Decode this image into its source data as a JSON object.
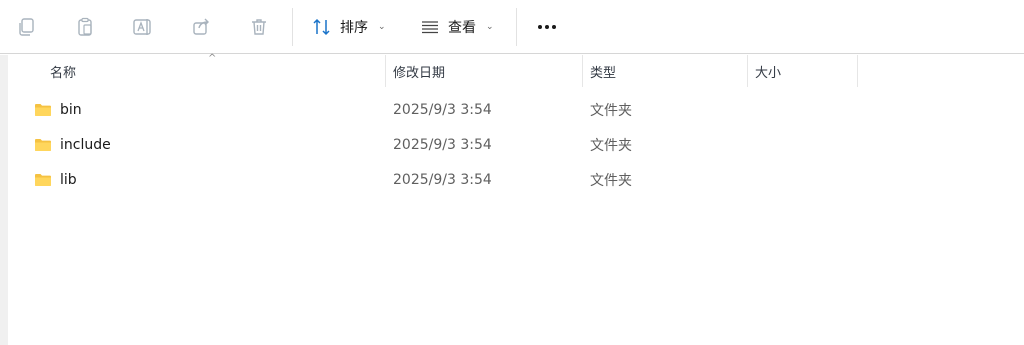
{
  "toolbar": {
    "icons": [
      "copy-icon",
      "paste-icon",
      "rename-icon",
      "share-icon",
      "delete-icon"
    ],
    "sort_label": "排序",
    "view_label": "查看",
    "accent": "#1a73c9"
  },
  "columns": {
    "name": "名称",
    "modified": "修改日期",
    "type": "类型",
    "size": "大小"
  },
  "files": [
    {
      "name": "bin",
      "modified": "2025/9/3 3:54",
      "type": "文件夹",
      "icon": "folder-icon"
    },
    {
      "name": "include",
      "modified": "2025/9/3 3:54",
      "type": "文件夹",
      "icon": "folder-icon"
    },
    {
      "name": "lib",
      "modified": "2025/9/3 3:54",
      "type": "文件夹",
      "icon": "folder-icon"
    }
  ]
}
